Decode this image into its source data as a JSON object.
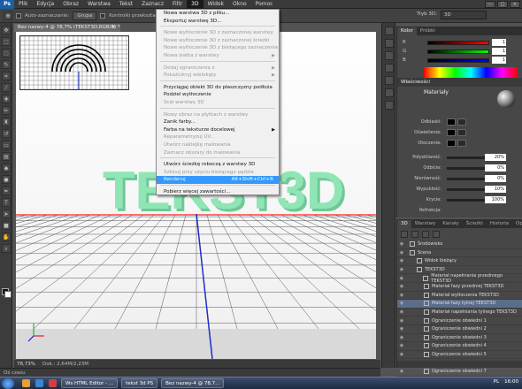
{
  "app": {
    "logo": "Ps"
  },
  "menu": [
    "Plik",
    "Edycja",
    "Obraz",
    "Warstwa",
    "Tekst",
    "Zaznacz",
    "Filtr",
    "3D",
    "Widok",
    "Okno",
    "Pomoc"
  ],
  "menu_active_index": 7,
  "window_controls": [
    "—",
    "□",
    "×"
  ],
  "options_bar": {
    "auto_select_label": "Auto-zaznaczanie:",
    "group_value": "Grupa",
    "transform_label": "Kontrolki przekształceń",
    "mode_label": "Tryb 3D:",
    "workspace": "3D"
  },
  "document": {
    "tab_title": "Bez nazwy-4 @ 78,7% (TEKST3D,RGB/8) *",
    "tab_close": "×",
    "text_3d": "TEKST3D",
    "zoom": "78,73%",
    "doc_info": "Dok.: 2,64M/2,23M",
    "text_color": "#8fe6b4"
  },
  "bottom_bar": {
    "label": "Oś czasu"
  },
  "menu_3d": {
    "items": [
      {
        "label": "Nowa warstwa 3D z pliku...",
        "state": "enabled"
      },
      {
        "label": "Eksportuj warstwę 3D...",
        "state": "enabled"
      },
      {
        "sep": true
      },
      {
        "label": "Nowe wytłoczenie 3D z zaznaczonej warstwy",
        "state": "disabled"
      },
      {
        "label": "Nowe wytłoczenie 3D z zaznaczonej ścieżki",
        "state": "disabled"
      },
      {
        "label": "Nowe wytłoczenie 3D z bieżącego zaznaczenia",
        "state": "disabled"
      },
      {
        "label": "Nowa siatka z warstwy",
        "state": "disabled",
        "submenu": true
      },
      {
        "sep": true
      },
      {
        "label": "Dodaj ograniczenia z",
        "state": "disabled",
        "submenu": true
      },
      {
        "label": "Pokaż/ukryj wielokąty",
        "state": "disabled",
        "submenu": true
      },
      {
        "sep": true
      },
      {
        "label": "Przyciągaj obiekt 3D do płaszczyzny podłoża",
        "state": "enabled"
      },
      {
        "label": "Podziel wytłoczenie",
        "state": "enabled"
      },
      {
        "label": "Scal warstwy 3D",
        "state": "disabled"
      },
      {
        "sep": true
      },
      {
        "label": "Nowy obraz na płytkach z warstwy",
        "state": "disabled"
      },
      {
        "label": "Zanik farby...",
        "state": "enabled"
      },
      {
        "label": "Farba na teksturze docelowej",
        "state": "enabled",
        "submenu": true
      },
      {
        "label": "Reparametryzuj UV...",
        "state": "disabled"
      },
      {
        "label": "Utwórz naklejkę malowania",
        "state": "disabled"
      },
      {
        "label": "Zaznacz obszary do malowania",
        "state": "disabled"
      },
      {
        "sep": true
      },
      {
        "label": "Utwórz ścieżkę roboczą z warstwy 3D",
        "state": "enabled"
      },
      {
        "label": "Szkicuj przy użyciu bieżącego pędzla",
        "state": "disabled"
      },
      {
        "label": "Renderuj",
        "state": "selected",
        "shortcut": "Alt+Shift+Ctrl+R"
      },
      {
        "sep": true
      },
      {
        "label": "Pobierz więcej zawartości...",
        "state": "enabled"
      }
    ]
  },
  "color_panel": {
    "tabs": [
      "Kolor",
      "Próbki"
    ],
    "channels": [
      {
        "label": "R",
        "value": "1"
      },
      {
        "label": "G",
        "value": "1"
      },
      {
        "label": "B",
        "value": "1"
      }
    ]
  },
  "properties_panel": {
    "header": "Właściwości",
    "title": "Materiały",
    "swatches": [
      {
        "label": "Odblaski:"
      },
      {
        "label": "Oświetlenie:"
      },
      {
        "label": "Otoczenie:"
      }
    ],
    "sliders": [
      {
        "label": "Połyskliwość:",
        "value": "20%"
      },
      {
        "label": "Odbicie:",
        "value": "0%"
      },
      {
        "label": "Nierówność:",
        "value": "0%"
      },
      {
        "label": "Wypukłość:",
        "value": "10%"
      },
      {
        "label": "Krycie:",
        "value": "100%"
      }
    ],
    "footer_label": "Refrakcja:"
  },
  "layers_panel": {
    "tabs": [
      "3D",
      "Warstwy",
      "Kanały",
      "Ścieżki",
      "Historia",
      "Operacje"
    ],
    "active_tab": 0,
    "items": [
      {
        "label": "Środowisko",
        "indent": 0,
        "selected": false
      },
      {
        "label": "Scena",
        "indent": 0,
        "selected": false
      },
      {
        "label": "Widok bieżący",
        "indent": 1,
        "selected": false
      },
      {
        "label": "TEKST3D",
        "indent": 1,
        "selected": false
      },
      {
        "label": "Materiał napełniania przedniego TEKST3D",
        "indent": 2,
        "selected": false
      },
      {
        "label": "Materiał fazy przedniej TEKST3D",
        "indent": 2,
        "selected": false
      },
      {
        "label": "Materiał wytłoczenia TEKST3D",
        "indent": 2,
        "selected": false
      },
      {
        "label": "Materiał fazy tylnej TEKST3D",
        "indent": 2,
        "selected": true
      },
      {
        "label": "Materiał napełniania tylnego TEKST3D",
        "indent": 2,
        "selected": false
      },
      {
        "label": "Ograniczenie obwiedni 1",
        "indent": 2,
        "selected": false
      },
      {
        "label": "Ograniczenie obwiedni 2",
        "indent": 2,
        "selected": false
      },
      {
        "label": "Ograniczenie obwiedni 3",
        "indent": 2,
        "selected": false
      },
      {
        "label": "Ograniczenie obwiedni 4",
        "indent": 2,
        "selected": false
      },
      {
        "label": "Ograniczenie obwiedni 5",
        "indent": 2,
        "selected": false
      },
      {
        "label": "Ograniczenie obwiedni 6",
        "indent": 2,
        "selected": false
      },
      {
        "label": "Ograniczenie obwiedni 7",
        "indent": 2,
        "selected": false
      }
    ]
  },
  "taskbar": {
    "tasks": [
      "Ws HTML Editor - ...",
      "tekst 3d PS",
      "Bez nazwy-4 @ 78,7..."
    ],
    "lang": "PL",
    "time": "16:00"
  }
}
